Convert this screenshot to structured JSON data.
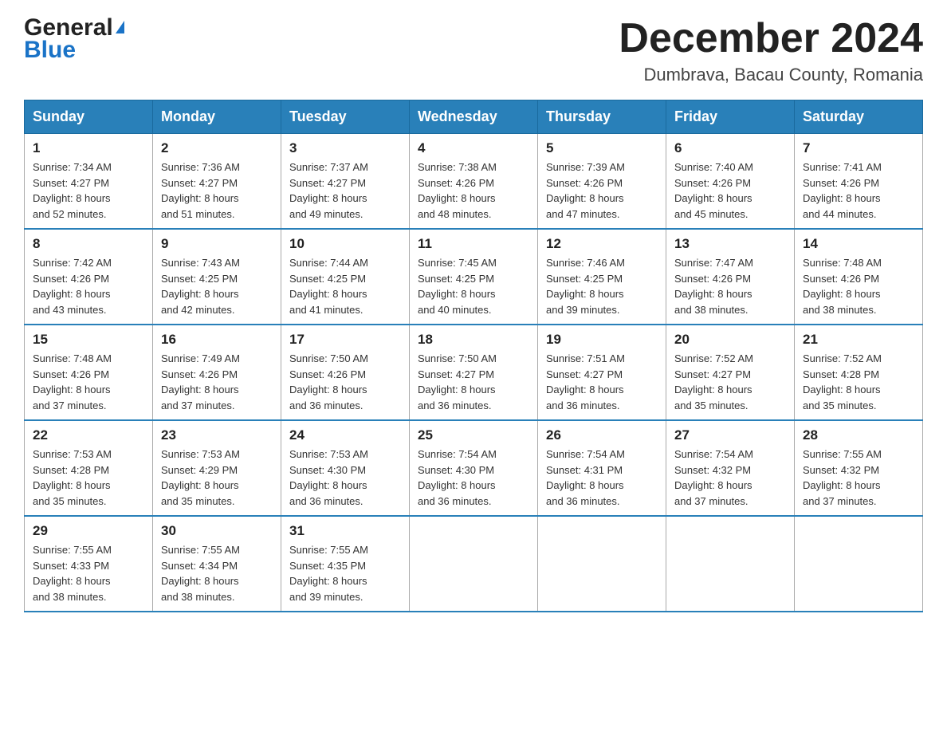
{
  "header": {
    "logo_general": "General",
    "logo_blue": "Blue",
    "month_title": "December 2024",
    "location": "Dumbrava, Bacau County, Romania"
  },
  "days_of_week": [
    "Sunday",
    "Monday",
    "Tuesday",
    "Wednesday",
    "Thursday",
    "Friday",
    "Saturday"
  ],
  "weeks": [
    [
      {
        "day": "1",
        "sunrise": "7:34 AM",
        "sunset": "4:27 PM",
        "daylight": "8 hours and 52 minutes."
      },
      {
        "day": "2",
        "sunrise": "7:36 AM",
        "sunset": "4:27 PM",
        "daylight": "8 hours and 51 minutes."
      },
      {
        "day": "3",
        "sunrise": "7:37 AM",
        "sunset": "4:27 PM",
        "daylight": "8 hours and 49 minutes."
      },
      {
        "day": "4",
        "sunrise": "7:38 AM",
        "sunset": "4:26 PM",
        "daylight": "8 hours and 48 minutes."
      },
      {
        "day": "5",
        "sunrise": "7:39 AM",
        "sunset": "4:26 PM",
        "daylight": "8 hours and 47 minutes."
      },
      {
        "day": "6",
        "sunrise": "7:40 AM",
        "sunset": "4:26 PM",
        "daylight": "8 hours and 45 minutes."
      },
      {
        "day": "7",
        "sunrise": "7:41 AM",
        "sunset": "4:26 PM",
        "daylight": "8 hours and 44 minutes."
      }
    ],
    [
      {
        "day": "8",
        "sunrise": "7:42 AM",
        "sunset": "4:26 PM",
        "daylight": "8 hours and 43 minutes."
      },
      {
        "day": "9",
        "sunrise": "7:43 AM",
        "sunset": "4:25 PM",
        "daylight": "8 hours and 42 minutes."
      },
      {
        "day": "10",
        "sunrise": "7:44 AM",
        "sunset": "4:25 PM",
        "daylight": "8 hours and 41 minutes."
      },
      {
        "day": "11",
        "sunrise": "7:45 AM",
        "sunset": "4:25 PM",
        "daylight": "8 hours and 40 minutes."
      },
      {
        "day": "12",
        "sunrise": "7:46 AM",
        "sunset": "4:25 PM",
        "daylight": "8 hours and 39 minutes."
      },
      {
        "day": "13",
        "sunrise": "7:47 AM",
        "sunset": "4:26 PM",
        "daylight": "8 hours and 38 minutes."
      },
      {
        "day": "14",
        "sunrise": "7:48 AM",
        "sunset": "4:26 PM",
        "daylight": "8 hours and 38 minutes."
      }
    ],
    [
      {
        "day": "15",
        "sunrise": "7:48 AM",
        "sunset": "4:26 PM",
        "daylight": "8 hours and 37 minutes."
      },
      {
        "day": "16",
        "sunrise": "7:49 AM",
        "sunset": "4:26 PM",
        "daylight": "8 hours and 37 minutes."
      },
      {
        "day": "17",
        "sunrise": "7:50 AM",
        "sunset": "4:26 PM",
        "daylight": "8 hours and 36 minutes."
      },
      {
        "day": "18",
        "sunrise": "7:50 AM",
        "sunset": "4:27 PM",
        "daylight": "8 hours and 36 minutes."
      },
      {
        "day": "19",
        "sunrise": "7:51 AM",
        "sunset": "4:27 PM",
        "daylight": "8 hours and 36 minutes."
      },
      {
        "day": "20",
        "sunrise": "7:52 AM",
        "sunset": "4:27 PM",
        "daylight": "8 hours and 35 minutes."
      },
      {
        "day": "21",
        "sunrise": "7:52 AM",
        "sunset": "4:28 PM",
        "daylight": "8 hours and 35 minutes."
      }
    ],
    [
      {
        "day": "22",
        "sunrise": "7:53 AM",
        "sunset": "4:28 PM",
        "daylight": "8 hours and 35 minutes."
      },
      {
        "day": "23",
        "sunrise": "7:53 AM",
        "sunset": "4:29 PM",
        "daylight": "8 hours and 35 minutes."
      },
      {
        "day": "24",
        "sunrise": "7:53 AM",
        "sunset": "4:30 PM",
        "daylight": "8 hours and 36 minutes."
      },
      {
        "day": "25",
        "sunrise": "7:54 AM",
        "sunset": "4:30 PM",
        "daylight": "8 hours and 36 minutes."
      },
      {
        "day": "26",
        "sunrise": "7:54 AM",
        "sunset": "4:31 PM",
        "daylight": "8 hours and 36 minutes."
      },
      {
        "day": "27",
        "sunrise": "7:54 AM",
        "sunset": "4:32 PM",
        "daylight": "8 hours and 37 minutes."
      },
      {
        "day": "28",
        "sunrise": "7:55 AM",
        "sunset": "4:32 PM",
        "daylight": "8 hours and 37 minutes."
      }
    ],
    [
      {
        "day": "29",
        "sunrise": "7:55 AM",
        "sunset": "4:33 PM",
        "daylight": "8 hours and 38 minutes."
      },
      {
        "day": "30",
        "sunrise": "7:55 AM",
        "sunset": "4:34 PM",
        "daylight": "8 hours and 38 minutes."
      },
      {
        "day": "31",
        "sunrise": "7:55 AM",
        "sunset": "4:35 PM",
        "daylight": "8 hours and 39 minutes."
      },
      null,
      null,
      null,
      null
    ]
  ],
  "labels": {
    "sunrise": "Sunrise:",
    "sunset": "Sunset:",
    "daylight": "Daylight:"
  }
}
